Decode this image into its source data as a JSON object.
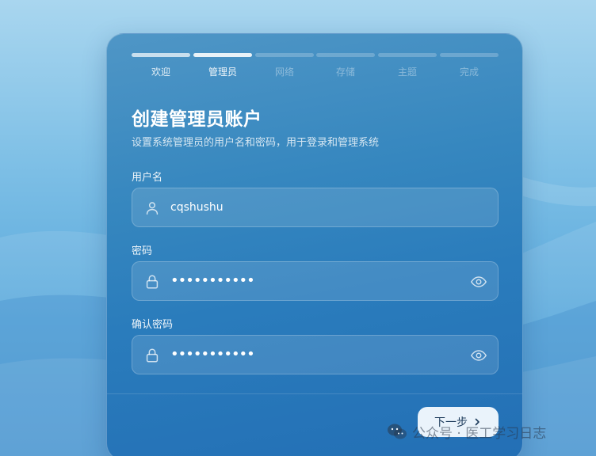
{
  "colors": {
    "accent": "#2a7cbc",
    "button_bg": "#eaf3fb",
    "button_text": "#1e3c5c"
  },
  "steps": [
    {
      "label": "欢迎",
      "state": "done"
    },
    {
      "label": "管理员",
      "state": "active"
    },
    {
      "label": "网络",
      "state": "pending"
    },
    {
      "label": "存储",
      "state": "pending"
    },
    {
      "label": "主题",
      "state": "pending"
    },
    {
      "label": "完成",
      "state": "pending"
    }
  ],
  "form": {
    "title": "创建管理员账户",
    "subtitle": "设置系统管理员的用户名和密码，用于登录和管理系统",
    "username": {
      "label": "用户名",
      "value": "cqshushu",
      "icon": "user-icon"
    },
    "password": {
      "label": "密码",
      "value": "•••••••••••",
      "icon": "lock-icon"
    },
    "confirm_password": {
      "label": "确认密码",
      "value": "•••••••••••",
      "icon": "lock-icon"
    }
  },
  "footer": {
    "next_label": "下一步"
  },
  "watermark": {
    "text": "公众号 · 医工学习日志",
    "icon": "wechat-icon"
  }
}
